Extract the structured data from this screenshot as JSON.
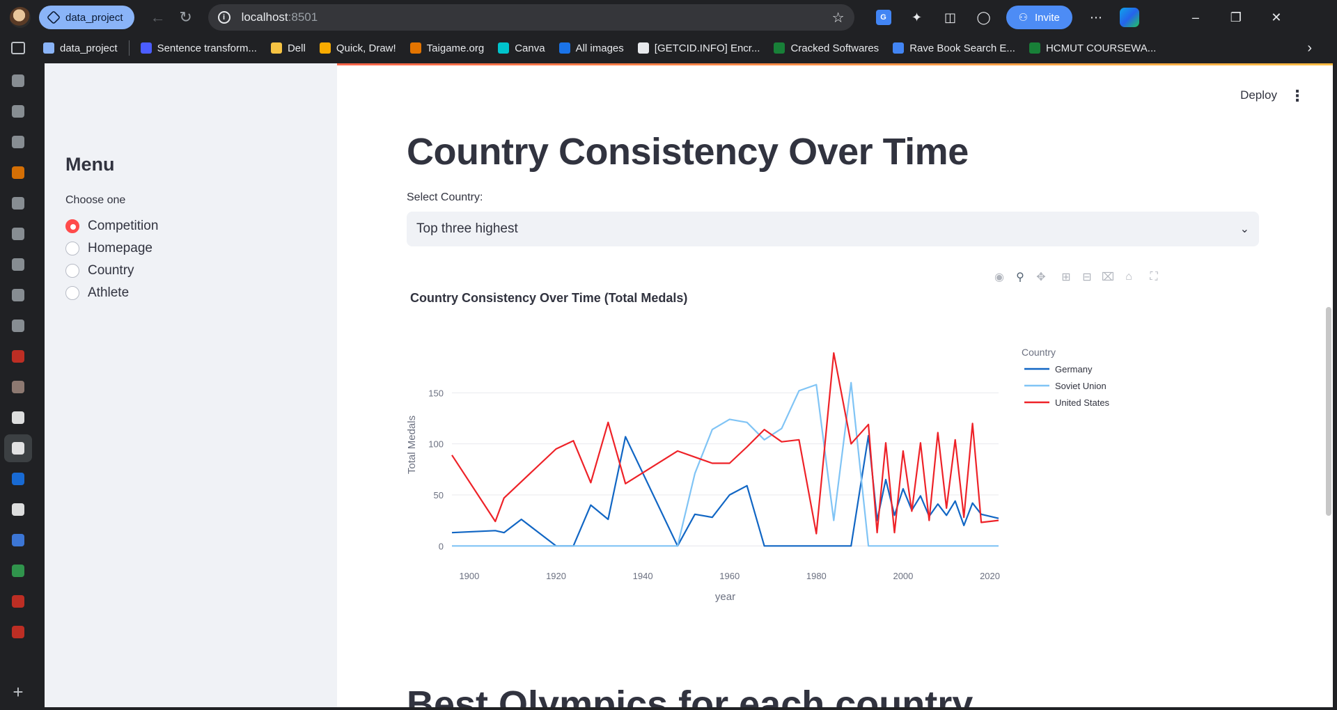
{
  "browser": {
    "tab_label": "data_project",
    "url_host": "localhost",
    "url_port": ":8501",
    "invite_label": "Invite",
    "bookmarks": [
      {
        "label": "data_project",
        "color": "#8ab4f8"
      },
      {
        "label": "Sentence transform...",
        "color": "#4b5dff"
      },
      {
        "label": "Dell",
        "color": "#f6c343"
      },
      {
        "label": "Quick, Draw!",
        "color": "#f9ab00"
      },
      {
        "label": "Taigame.org",
        "color": "#e37400"
      },
      {
        "label": "Canva",
        "color": "#00c4cc"
      },
      {
        "label": "All images",
        "color": "#1a73e8"
      },
      {
        "label": "[GETCID.INFO] Encr...",
        "color": "#e8eaed"
      },
      {
        "label": "Cracked Softwares",
        "color": "#188038"
      },
      {
        "label": "Rave Book Search E...",
        "color": "#4285f4"
      },
      {
        "label": "HCMUT COURSEWA...",
        "color": "#188038"
      }
    ],
    "strip_colors": [
      "#9aa0a6",
      "#9aa0a6",
      "#9aa0a6",
      "#f57c00",
      "#9aa0a6",
      "#9aa0a6",
      "#9aa0a6",
      "#9aa0a6",
      "#9aa0a6",
      "#d93025",
      "#a1887f",
      "#ffffff",
      "#ffffff",
      "#1877f2",
      "#ffffff",
      "#4285f4",
      "#34a853",
      "#d93025",
      "#d93025"
    ]
  },
  "sidebar": {
    "title": "Menu",
    "radio_label": "Choose one",
    "options": [
      "Competition",
      "Homepage",
      "Country",
      "Athlete"
    ],
    "selected_index": 0
  },
  "header": {
    "deploy_label": "Deploy"
  },
  "main": {
    "title": "Country Consistency Over Time",
    "select_label": "Select Country:",
    "select_value": "Top three highest",
    "next_heading": "Best Olympics for each country"
  },
  "chart_data": {
    "type": "line",
    "title": "Country Consistency Over Time (Total Medals)",
    "xlabel": "year",
    "ylabel": "Total Medals",
    "legend_title": "Country",
    "legend_position": "top-right",
    "xlim": [
      1896,
      2022
    ],
    "ylim": [
      -8,
      200
    ],
    "x_ticks": [
      1900,
      1920,
      1940,
      1960,
      1980,
      2000,
      2020
    ],
    "y_ticks": [
      0,
      50,
      100,
      150
    ],
    "grid": true,
    "series": [
      {
        "name": "Germany",
        "color": "#1166c4",
        "x": [
          1896,
          1906,
          1908,
          1912,
          1920,
          1924,
          1928,
          1932,
          1936,
          1948,
          1952,
          1956,
          1960,
          1964,
          1968,
          1988,
          1992,
          1994,
          1996,
          1998,
          2000,
          2002,
          2004,
          2006,
          2008,
          2010,
          2012,
          2014,
          2016,
          2018,
          2022
        ],
        "y": [
          13,
          15,
          13,
          26,
          0,
          0,
          40,
          26,
          107,
          0,
          31,
          28,
          50,
          59,
          0,
          0,
          108,
          25,
          65,
          30,
          56,
          35,
          49,
          29,
          41,
          30,
          44,
          20,
          42,
          31,
          27
        ]
      },
      {
        "name": "Soviet Union",
        "color": "#80c4f5",
        "x": [
          1896,
          1948,
          1952,
          1956,
          1960,
          1964,
          1968,
          1972,
          1976,
          1980,
          1984,
          1988,
          1992,
          1994,
          2022
        ],
        "y": [
          0,
          0,
          71,
          114,
          124,
          121,
          104,
          115,
          152,
          158,
          25,
          160,
          0,
          0,
          0
        ]
      },
      {
        "name": "United States",
        "color": "#ee2228",
        "x": [
          1896,
          1906,
          1908,
          1912,
          1920,
          1924,
          1928,
          1932,
          1936,
          1948,
          1952,
          1956,
          1960,
          1964,
          1968,
          1972,
          1976,
          1980,
          1984,
          1988,
          1992,
          1994,
          1996,
          1998,
          2000,
          2002,
          2004,
          2006,
          2008,
          2010,
          2012,
          2014,
          2016,
          2018,
          2022
        ],
        "y": [
          89,
          24,
          47,
          63,
          95,
          103,
          62,
          121,
          61,
          93,
          87,
          81,
          81,
          97,
          114,
          102,
          104,
          12,
          189,
          100,
          119,
          13,
          101,
          13,
          93,
          34,
          101,
          25,
          111,
          37,
          104,
          28,
          120,
          23,
          25
        ]
      }
    ]
  }
}
